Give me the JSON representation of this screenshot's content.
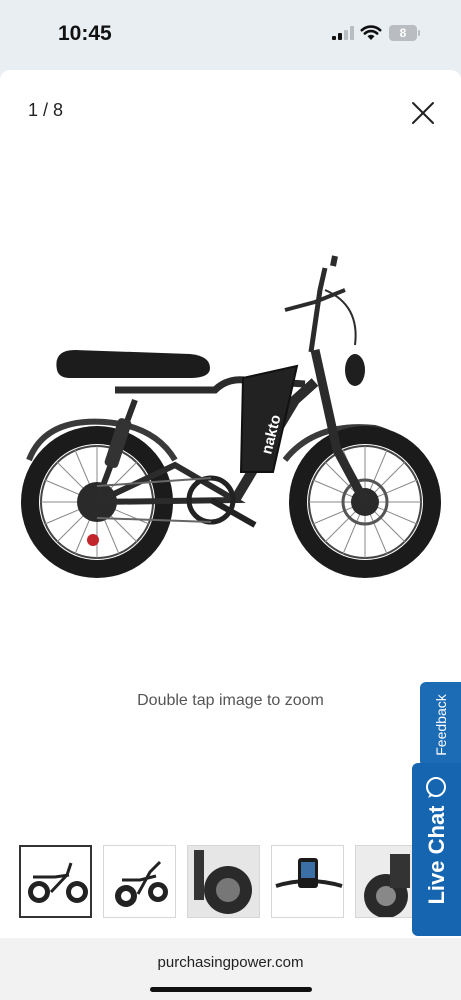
{
  "status_bar": {
    "time": "10:45",
    "battery": "8"
  },
  "viewer": {
    "counter": "1 / 8",
    "zoom_hint": "Double tap image to zoom",
    "brand_on_frame": "nakto"
  },
  "side_tabs": {
    "feedback": "Feedback",
    "live_chat": "Live Chat"
  },
  "footer": {
    "url": "purchasingpower.com"
  },
  "icons": {
    "close": "close-icon",
    "chat": "chat-bubble-icon"
  },
  "colors": {
    "accent": "#1565b0"
  }
}
